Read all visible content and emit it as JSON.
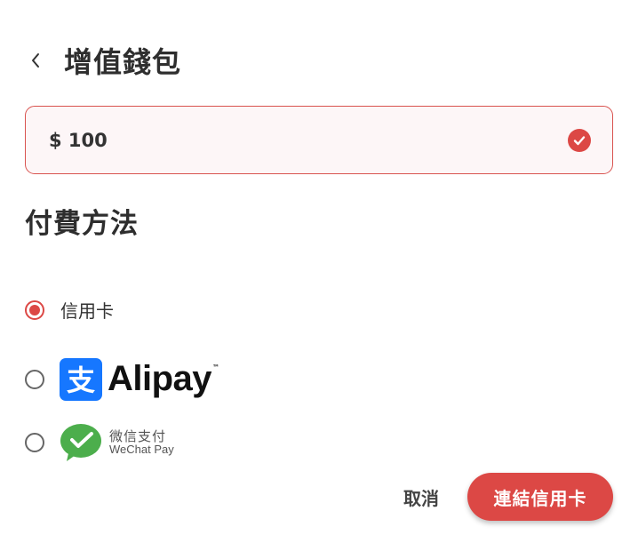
{
  "header": {
    "title": "增值錢包",
    "back_icon": "chevron-left-icon"
  },
  "amount": {
    "value": "$ 100",
    "status_icon": "check-circle-icon",
    "accent_color": "#dc4845"
  },
  "payment": {
    "section_title": "付費方法",
    "options": [
      {
        "id": "credit-card",
        "label": "信用卡",
        "selected": true
      },
      {
        "id": "alipay",
        "logo_text": "Alipay",
        "logo_mark": "支",
        "trademark": "™",
        "selected": false
      },
      {
        "id": "wechat-pay",
        "logo_text_cn": "微信支付",
        "logo_text_en": "WeChat Pay",
        "selected": false
      }
    ]
  },
  "actions": {
    "cancel_label": "取消",
    "primary_label": "連結信用卡"
  }
}
